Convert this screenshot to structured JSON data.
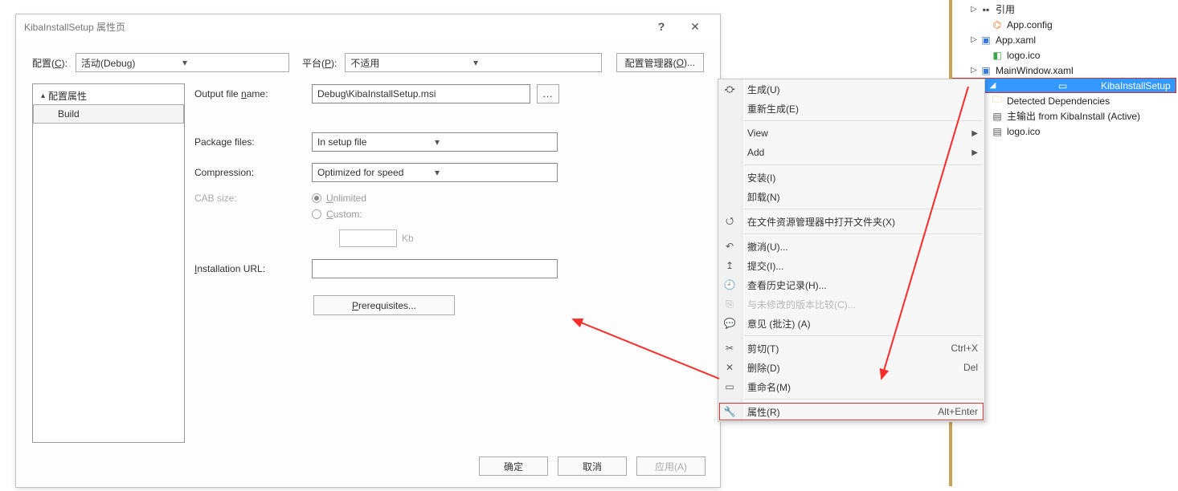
{
  "dlg": {
    "title": "KibaInstallSetup 属性页",
    "help": "?",
    "close": "✕",
    "config_label_pre": "配置(",
    "config_mnem": "C",
    "config_label_post": "):",
    "config_value": "活动(Debug)",
    "platform_label_pre": "平台(",
    "platform_mnem": "P",
    "platform_label_post": "):",
    "platform_value": "不适用",
    "cfgmgr_pre": "配置管理器(",
    "cfgmgr_mnem": "O",
    "cfgmgr_post": ")...",
    "tree": {
      "root": "配置属性",
      "build": "Build"
    },
    "output_label": "Output file name:",
    "output_mnem": "n",
    "output_value": "Debug\\KibaInstallSetup.msi",
    "browse": "...",
    "package_label": "Package files:",
    "package_value": "In setup file",
    "compression_label": "Compression:",
    "compression_value": "Optimized for speed",
    "cab_label": "CAB size:",
    "radio_unlimited": "Unlimited",
    "radio_unlimited_mnem": "U",
    "radio_custom": "Custom:",
    "radio_custom_mnem": "C",
    "kb_unit": "Kb",
    "url_label": "Installation URL:",
    "url_mnem": "I",
    "prereq_btn_pre": "",
    "prereq_btn_mnem": "P",
    "prereq_btn_post": "rerequisites...",
    "ok": "确定",
    "cancel": "取消",
    "apply": "应用(A)"
  },
  "ctx": {
    "build": "生成(U)",
    "rebuild": "重新生成(E)",
    "view": "View",
    "add": "Add",
    "install": "安装(I)",
    "uninstall": "卸载(N)",
    "openfolder": "在文件资源管理器中打开文件夹(X)",
    "undo": "撤消(U)...",
    "commit": "提交(I)...",
    "history": "查看历史记录(H)...",
    "compare": "与未修改的版本比较(C)...",
    "annotate": "意见 (批注) (A)",
    "cut": "剪切(T)",
    "cut_sc": "Ctrl+X",
    "delete": "删除(D)",
    "delete_sc": "Del",
    "rename": "重命名(M)",
    "props": "属性(R)",
    "props_sc": "Alt+Enter"
  },
  "sol": {
    "ref": "引用",
    "appconfig": "App.config",
    "appxaml": "App.xaml",
    "logoico": "logo.ico",
    "mainwin": "MainWindow.xaml",
    "kiba": "KibaInstallSetup",
    "detected": "Detected Dependencies",
    "output": "主输出 from KibaInstall (Active)",
    "logoico2": "logo.ico"
  }
}
